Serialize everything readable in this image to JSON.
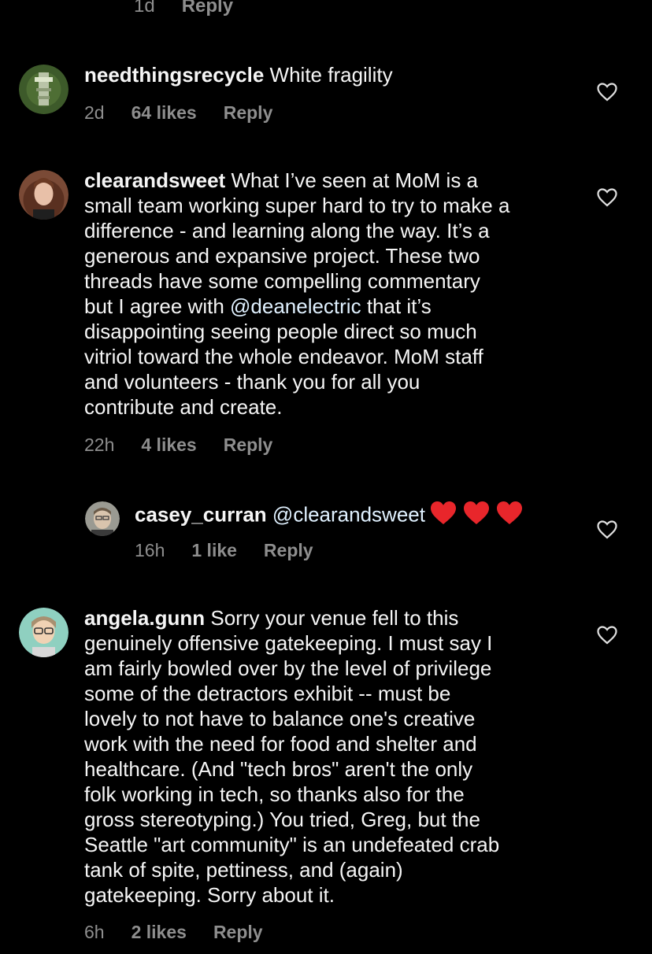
{
  "top_meta": {
    "time": "1d",
    "reply": "Reply"
  },
  "comments": [
    {
      "username": "needthingsrecycle",
      "text": "White fragility",
      "time": "2d",
      "likes": "64 likes",
      "reply": "Reply",
      "avatar_colors": {
        "bg": "#3d5a2a",
        "fg": "#c8d4b8"
      }
    },
    {
      "username": "clearandsweet",
      "text_before": "What I’ve seen at MoM is a\nsmall team working super hard to try to make a\ndifference - and learning along the way. It’s a\ngenerous and expansive project. These two\nthreads have some compelling commentary\nbut I agree with ",
      "mention": "@deanelectric",
      "text_after": " that it’s\ndisappointing seeing people direct so much\nvitriol toward the whole endeavor. MoM staff\nand volunteers - thank you for all you\ncontribute and create.",
      "time": "22h",
      "likes": "4 likes",
      "reply": "Reply",
      "avatar_colors": {
        "bg": "#7a4a36",
        "fg": "#e8c0a8"
      }
    },
    {
      "username": "casey_curran",
      "mention": "@clearandsweet",
      "time": "16h",
      "likes": "1 like",
      "reply": "Reply",
      "avatar_colors": {
        "bg": "#9a9a92",
        "fg": "#d9c4ad"
      }
    },
    {
      "username": "angela.gunn",
      "text": "Sorry your venue fell to this\ngenuinely offensive gatekeeping. I must say I\nam fairly bowled over by the level of privilege\nsome of the detractors exhibit -- must be\nlovely to not have to balance one's creative\nwork with the need for food and shelter and\nhealthcare. (And \"tech bros\" aren't the only\nfolk working in tech, so thanks also for the\ngross stereotyping.) You tried, Greg, but the\nSeattle \"art community\" is an undefeated crab\ntank of spite, pettiness, and (again)\ngatekeeping. Sorry about it.",
      "time": "6h",
      "likes": "2 likes",
      "reply": "Reply",
      "avatar_colors": {
        "bg": "#8fd0c0",
        "fg": "#f0d2b4"
      }
    }
  ],
  "colors": {
    "background": "#000000",
    "text": "#f5f5f5",
    "meta": "#8e8e8e",
    "heart_outline": "#e0e0e0",
    "heart_emoji": "#e8262b"
  }
}
